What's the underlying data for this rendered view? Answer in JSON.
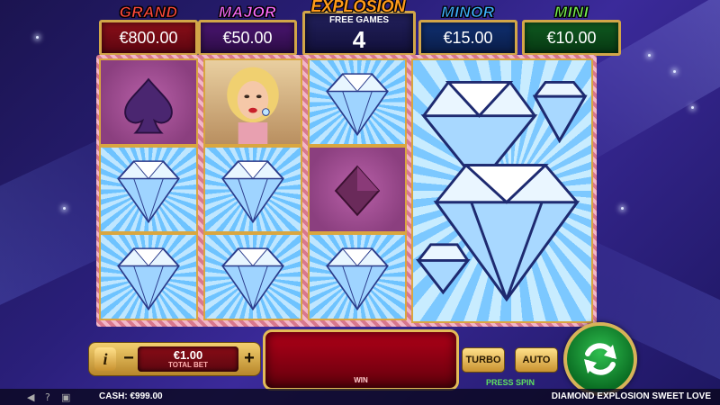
{
  "jackpots": {
    "grand": {
      "title": "GRAND",
      "amount": "€800.00"
    },
    "major": {
      "title": "MAJOR",
      "amount": "€50.00"
    },
    "minor": {
      "title": "MINOR",
      "amount": "€15.00"
    },
    "mini": {
      "title": "MINI",
      "amount": "€10.00"
    }
  },
  "free_games": {
    "title": "EXPLOSION",
    "label": "FREE GAMES",
    "count": "4"
  },
  "reels": {
    "symbols": [
      [
        "spade",
        "diamond-gem",
        "diamond-gem"
      ],
      [
        "woman",
        "diamond-gem",
        "diamond-gem"
      ],
      [
        "diamond-gem",
        "diamond-suit",
        "diamond-gem"
      ]
    ],
    "big_symbol": "diamond-cluster"
  },
  "bet": {
    "info_label": "i",
    "minus_label": "−",
    "plus_label": "+",
    "value": "€1.00",
    "label": "TOTAL BET"
  },
  "win": {
    "label": "WIN"
  },
  "buttons": {
    "turbo": "TURBO",
    "auto": "AUTO",
    "press_spin": "PRESS SPIN"
  },
  "footer": {
    "cash": "CASH: €999.00",
    "game_title": "DIAMOND EXPLOSION SWEET LOVE"
  },
  "colors": {
    "accent_gold": "#d9a640",
    "grand_red": "#ff4a3c",
    "major_pink": "#ff6cff",
    "minor_blue": "#3fb3ff",
    "mini_green": "#78f050",
    "spin_green": "#0b6e23"
  }
}
